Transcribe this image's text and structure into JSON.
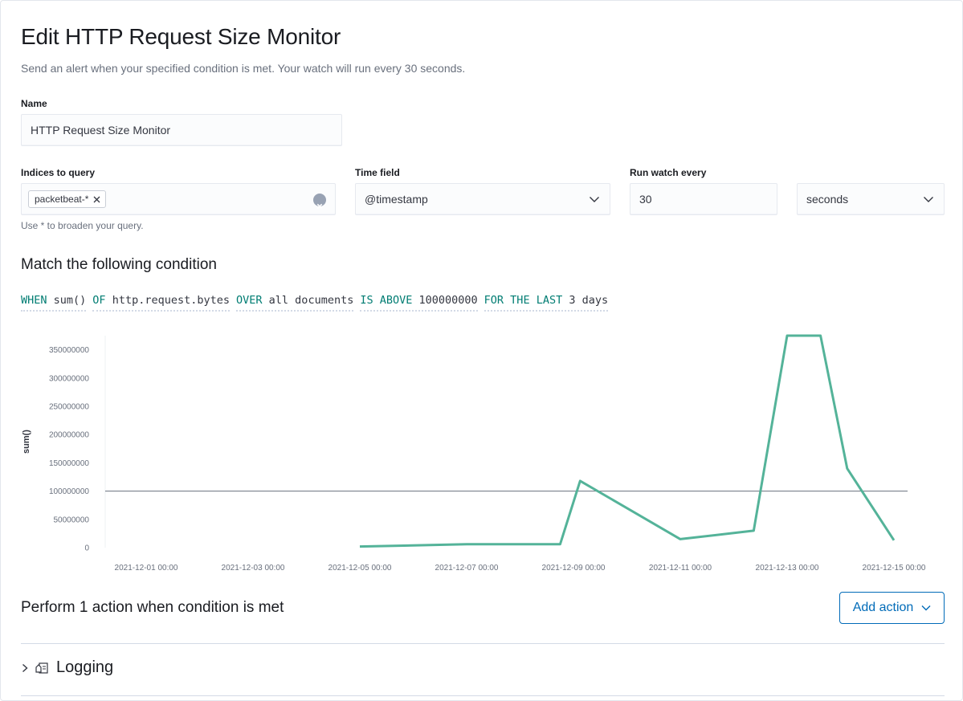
{
  "page": {
    "title": "Edit HTTP Request Size Monitor",
    "subtitle": "Send an alert when your specified condition is met. Your watch will run every 30 seconds."
  },
  "form": {
    "name_label": "Name",
    "name_value": "HTTP Request Size Monitor",
    "indices_label": "Indices to query",
    "index_pill": "packetbeat-*",
    "indices_help": "Use * to broaden your query.",
    "time_field_label": "Time field",
    "time_field_value": "@timestamp",
    "run_every_label": "Run watch every",
    "run_every_value": "30",
    "run_every_unit": "seconds"
  },
  "condition": {
    "heading": "Match the following condition",
    "expression": [
      {
        "kw": "WHEN",
        "val": "sum()"
      },
      {
        "kw": "OF",
        "val": "http.request.bytes"
      },
      {
        "kw": "OVER",
        "val": "all documents"
      },
      {
        "kw": "IS ABOVE",
        "val": "100000000"
      },
      {
        "kw": "FOR THE LAST",
        "val": "3 days"
      }
    ]
  },
  "chart_data": {
    "type": "line",
    "ylabel": "sum()",
    "x_ticks": [
      "2021-12-01 00:00",
      "2021-12-03 00:00",
      "2021-12-05 00:00",
      "2021-12-07 00:00",
      "2021-12-09 00:00",
      "2021-12-11 00:00",
      "2021-12-13 00:00",
      "2021-12-15 00:00"
    ],
    "y_ticks": [
      "0",
      "50000000",
      "100000000",
      "150000000",
      "200000000",
      "250000000",
      "300000000",
      "350000000"
    ],
    "ylim": [
      0,
      375000000
    ],
    "threshold": 100000000,
    "series": [
      {
        "color": "#54b399",
        "points": [
          {
            "x": "2021-12-05 00:00",
            "y": 2000000
          },
          {
            "x": "2021-12-07 00:00",
            "y": 6000000
          },
          {
            "x": "2021-12-08 18:00",
            "y": 6000000
          },
          {
            "x": "2021-12-09 03:00",
            "y": 118000000
          },
          {
            "x": "2021-12-11 00:00",
            "y": 15000000
          },
          {
            "x": "2021-12-12 09:00",
            "y": 30000000
          },
          {
            "x": "2021-12-13 00:00",
            "y": 375000000
          },
          {
            "x": "2021-12-13 15:00",
            "y": 375000000
          },
          {
            "x": "2021-12-14 03:00",
            "y": 140000000
          },
          {
            "x": "2021-12-15 00:00",
            "y": 13000000
          }
        ]
      }
    ],
    "threshold_color": "#69707d",
    "grid": false
  },
  "actions": {
    "heading": "Perform 1 action when condition is met",
    "add_action_label": "Add action",
    "items": [
      {
        "label": "Logging",
        "icon": "logging-icon"
      }
    ]
  },
  "colors": {
    "keyword": "#017d73",
    "primary": "#006bb8",
    "series": "#54b399"
  }
}
